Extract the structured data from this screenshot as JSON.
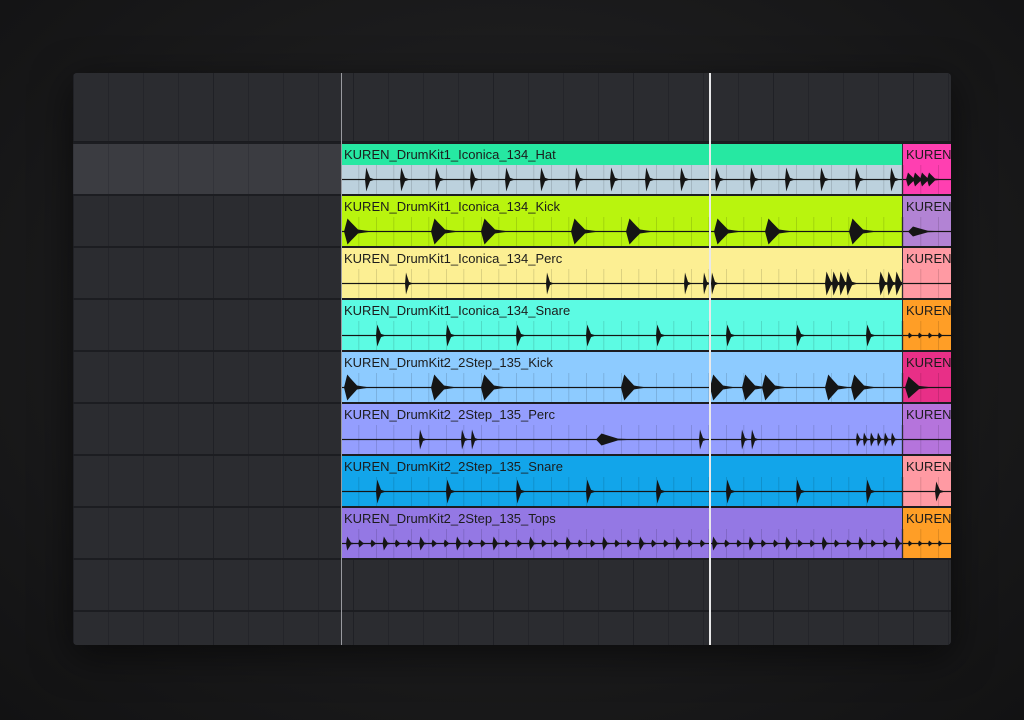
{
  "arrangement": {
    "tracks": [
      {
        "clips": [
          {
            "name": "KUREN_DrumKit1_Iconica_134_Hat",
            "color": "#26e8a2",
            "wave_color": "#bcd1dd",
            "wave": "hat"
          },
          {
            "name": "KUREN",
            "color": "#ff3fb1",
            "wave_color": "#ff3fb1",
            "wave": "dense"
          }
        ]
      },
      {
        "clips": [
          {
            "name": "KUREN_DrumKit1_Iconica_134_Kick",
            "color": "#b9f40e",
            "wave_color": "#b9f40e",
            "wave": "kick1"
          },
          {
            "name": "KUREN",
            "color": "#b283d4",
            "wave_color": "#b283d4",
            "wave": "small"
          }
        ]
      },
      {
        "clips": [
          {
            "name": "KUREN_DrumKit1_Iconica_134_Perc",
            "color": "#fcef93",
            "wave_color": "#fcef93",
            "wave": "perc1"
          },
          {
            "name": "KUREN",
            "color": "#ff9aa3",
            "wave_color": "#ff9aa3",
            "wave": "none"
          }
        ]
      },
      {
        "clips": [
          {
            "name": "KUREN_DrumKit1_Iconica_134_Snare",
            "color": "#5cfbe3",
            "wave_color": "#5cfbe3",
            "wave": "snare1"
          },
          {
            "name": "KUREN",
            "color": "#ff9e26",
            "wave_color": "#ff9e26",
            "wave": "tiny"
          }
        ]
      },
      {
        "clips": [
          {
            "name": "KUREN_DrumKit2_2Step_135_Kick",
            "color": "#8dcbff",
            "wave_color": "#8dcbff",
            "wave": "kick2"
          },
          {
            "name": "KUREN",
            "color": "#e82f87",
            "wave_color": "#e82f87",
            "wave": "kickstart"
          }
        ]
      },
      {
        "clips": [
          {
            "name": "KUREN_DrumKit2_2Step_135_Perc",
            "color": "#949efe",
            "wave_color": "#949efe",
            "wave": "perc2"
          },
          {
            "name": "KUREN",
            "color": "#b574dc",
            "wave_color": "#b574dc",
            "wave": "none"
          }
        ]
      },
      {
        "clips": [
          {
            "name": "KUREN_DrumKit2_2Step_135_Snare",
            "color": "#12a5ea",
            "wave_color": "#12a5ea",
            "wave": "snare2"
          },
          {
            "name": "KUREN",
            "color": "#ff9aa3",
            "wave_color": "#ff9aa3",
            "wave": "one"
          }
        ]
      },
      {
        "clips": [
          {
            "name": "KUREN_DrumKit2_2Step_135_Tops",
            "color": "#9478e4",
            "wave_color": "#9478e4",
            "wave": "tops"
          },
          {
            "name": "KUREN",
            "color": "#ff9e26",
            "wave_color": "#ff9e26",
            "wave": "tiny"
          }
        ]
      }
    ]
  },
  "colors": {
    "background": "#1a1a1b",
    "panel": "#2b2c30",
    "grid_line": "#24252a",
    "waveform": "#151515",
    "playhead": "#e9e9ea"
  },
  "icons": []
}
